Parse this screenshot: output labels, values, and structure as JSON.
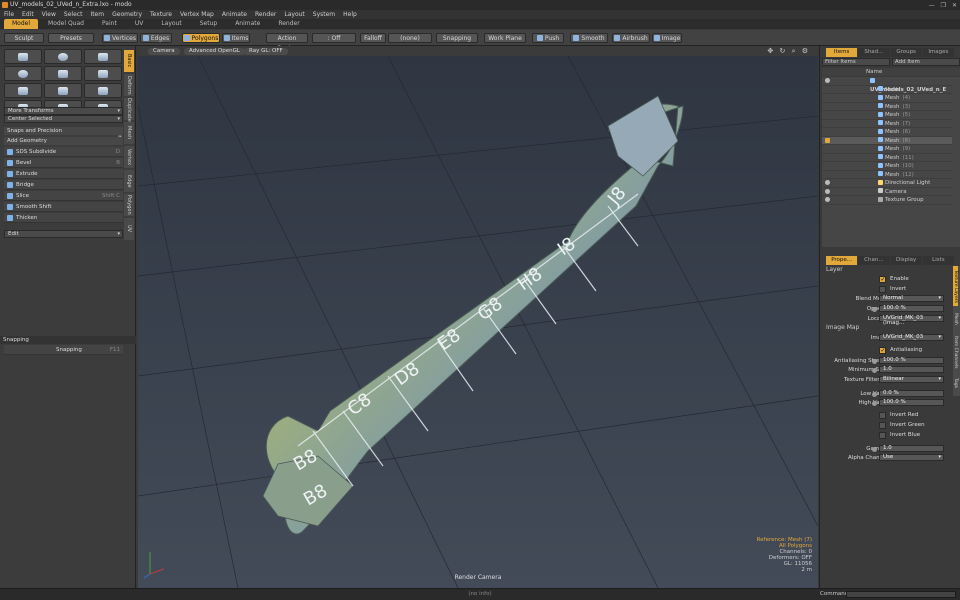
{
  "app": {
    "title": "UV_models_02_UVed_n_Extra.lxo - modo",
    "window_controls": [
      "—",
      "❐",
      "✕"
    ]
  },
  "menu": [
    "File",
    "Edit",
    "View",
    "Select",
    "Item",
    "Geometry",
    "Texture",
    "Vertex Map",
    "Animate",
    "Render",
    "Layout",
    "System",
    "Help"
  ],
  "layout_tabs": [
    {
      "label": "Model",
      "active": true
    },
    {
      "label": "Model Quad"
    },
    {
      "label": "Paint"
    },
    {
      "label": "UV"
    },
    {
      "label": "Layout"
    },
    {
      "label": "Setup"
    },
    {
      "label": "Animate"
    },
    {
      "label": "Render"
    }
  ],
  "toolbar": {
    "sculpt": "Sculpt",
    "presets": "Presets",
    "vertices": "Vertices",
    "edges": "Edges",
    "polygons": "Polygons",
    "items": "Items",
    "action_center": "Action Center",
    "symmetry": ": Off",
    "falloff": "Falloff",
    "falloff_value": "(none)",
    "snapping": "Snapping",
    "work_plane": "Work Plane",
    "push": "Push",
    "smooth": "Smooth",
    "airbrush": "Airbrush",
    "image": "Image"
  },
  "left_panel": {
    "side_tabs": [
      "Basic",
      "Deform",
      "Duplicate",
      "Mesh Edit",
      "Vertex",
      "Edge",
      "Polygon",
      "UV"
    ],
    "more_transforms": "More Transforms",
    "center_selected": "Center Selected",
    "snaps_header": "Snaps and Precision",
    "add_geometry": "Add Geometry",
    "tools": [
      {
        "label": "SDS Subdivide",
        "shortcut": "D"
      },
      {
        "label": "Bevel",
        "shortcut": "B"
      },
      {
        "label": "Extrude",
        "shortcut": ""
      },
      {
        "label": "Bridge",
        "shortcut": ""
      },
      {
        "label": "Slice",
        "shortcut": "Shift C"
      },
      {
        "label": "Smooth Shift",
        "shortcut": ""
      },
      {
        "label": "Thicken",
        "shortcut": ""
      }
    ],
    "edit": "Edit",
    "snapping_header": "Snapping",
    "snapping_value": "Snapping",
    "snapping_shortcut": "F11"
  },
  "viewport": {
    "camera": "Camera",
    "shading": "Advanced OpenGL",
    "raygl": "Ray GL: OFF",
    "icons": "✥ ↻ ⌕ ⚙",
    "info": {
      "reference": "Reference: Mesh (7)",
      "polygons": "All Polygons",
      "channels": "Channels: 0",
      "deformers": "Deformers: OFF",
      "gl": "GL: 11056",
      "scale": "2 m"
    },
    "footer": "Render Camera",
    "wrench_labels": [
      "B8",
      "C8",
      "D8",
      "E8",
      "G8",
      "H8",
      "I8",
      "J8",
      "B8"
    ]
  },
  "right_panel": {
    "tabs_top": [
      {
        "label": "Items",
        "active": true
      },
      {
        "label": "Shad..."
      },
      {
        "label": "Groups"
      },
      {
        "label": "Images"
      }
    ],
    "filter_items": "Filter Items",
    "add_item": "Add Item",
    "name_col": "Name",
    "items": [
      {
        "name": "UV_models_02_UVed_n_E",
        "sub": "",
        "indent": 0,
        "bold": true,
        "eye": true
      },
      {
        "name": "Mesh",
        "sub": "",
        "indent": 1,
        "eye": false
      },
      {
        "name": "Mesh",
        "sub": "(4)",
        "indent": 1,
        "eye": false
      },
      {
        "name": "Mesh",
        "sub": "(3)",
        "indent": 1,
        "eye": false
      },
      {
        "name": "Mesh",
        "sub": "(5)",
        "indent": 1,
        "eye": false
      },
      {
        "name": "Mesh",
        "sub": "(7)",
        "indent": 1,
        "eye": false
      },
      {
        "name": "Mesh",
        "sub": "(6)",
        "indent": 1,
        "eye": false
      },
      {
        "name": "Mesh",
        "sub": "(8)",
        "indent": 1,
        "eye": true,
        "selected": true
      },
      {
        "name": "Mesh",
        "sub": "(9)",
        "indent": 1,
        "eye": false
      },
      {
        "name": "Mesh",
        "sub": "(11)",
        "indent": 1,
        "eye": false
      },
      {
        "name": "Mesh",
        "sub": "(10)",
        "indent": 1,
        "eye": false
      },
      {
        "name": "Mesh",
        "sub": "(12)",
        "indent": 1,
        "eye": false
      },
      {
        "name": "Directional Light",
        "sub": "",
        "indent": 1,
        "eye": true
      },
      {
        "name": "Camera",
        "sub": "",
        "indent": 1,
        "eye": true
      },
      {
        "name": "Texture Group",
        "sub": "",
        "indent": 1,
        "eye": true
      }
    ],
    "tabs_props": [
      {
        "label": "Prope...",
        "active": true
      },
      {
        "label": "Chan..."
      },
      {
        "label": "Display"
      },
      {
        "label": "Lists"
      }
    ],
    "side_tabs_props": [
      "Texture Layers",
      "Mesh",
      "Item Channels",
      "Tags"
    ],
    "layer_header": "Layer",
    "enable": "Enable",
    "invert": "Invert",
    "blend_mode_label": "Blend Mode",
    "blend_mode": "Normal",
    "opacity_label": "Opacity",
    "opacity": "100.0 %",
    "locator_label": "Locator",
    "locator": "UVGrid_MK_03 (Imag...",
    "image_map_header": "Image Map",
    "image_label": "Image",
    "image": "UVGrid_MK_03",
    "antialiasing": "Antialiasing",
    "aa_strength_label": "Antialiasing Stren...",
    "aa_strength": "100.0 %",
    "min_spot_label": "Minimum Spot",
    "min_spot": "1.0",
    "tex_filter_label": "Texture Filtering",
    "tex_filter": "Bilinear",
    "low_value_label": "Low Value",
    "low_value": "0.0 %",
    "high_value_label": "High Value",
    "high_value": "100.0 %",
    "invert_red": "Invert Red",
    "invert_green": "Invert Green",
    "invert_blue": "Invert Blue",
    "gamma_label": "Gamma",
    "gamma": "1.0",
    "alpha_label": "Alpha Channel",
    "alpha": "Use"
  },
  "statusbar": {
    "center": "(no info)",
    "command_label": "Command"
  },
  "colors": {
    "accent": "#e3a83a",
    "viewport_bg": "#3a4250"
  }
}
